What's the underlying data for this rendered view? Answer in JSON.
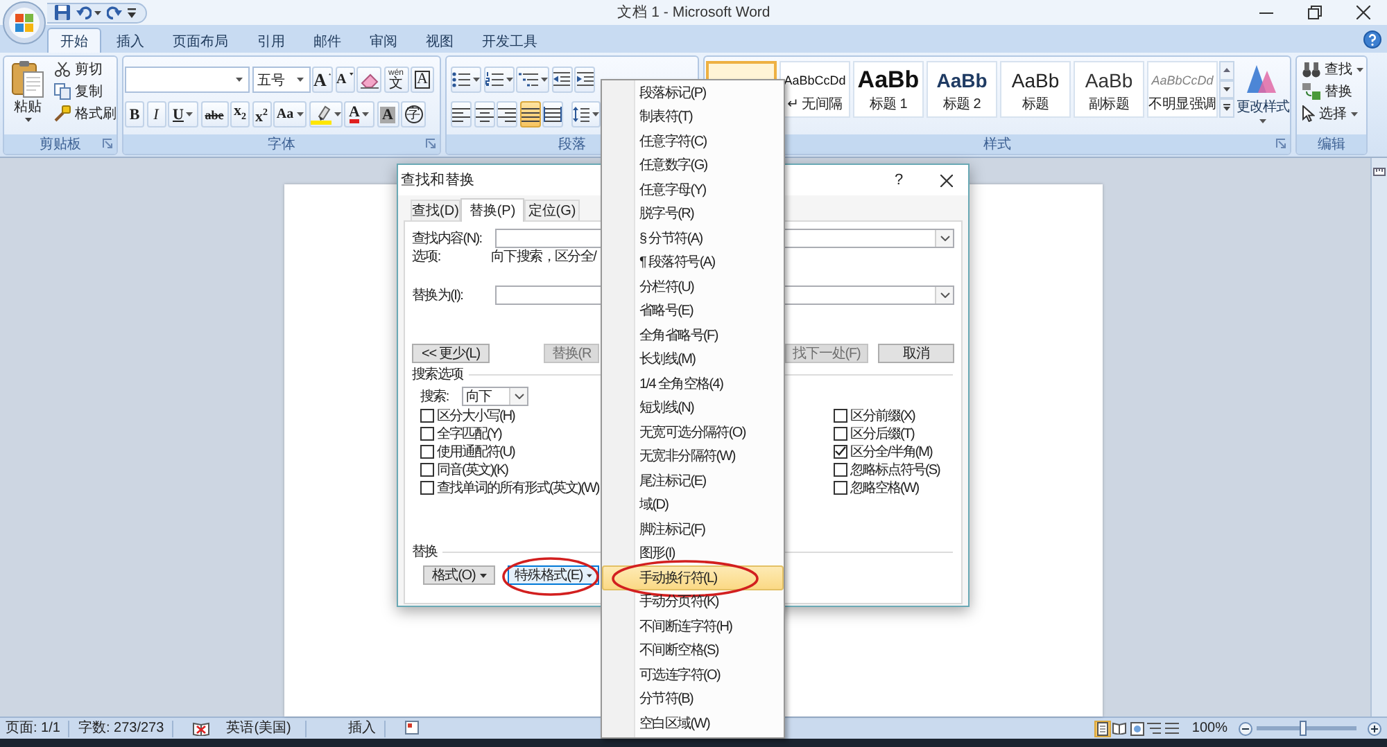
{
  "window": {
    "title": "文档 1 - Microsoft Word"
  },
  "quick_access": [
    {
      "kind": "save",
      "dropdown": false
    },
    {
      "kind": "undo",
      "dropdown": true
    },
    {
      "kind": "redo",
      "dropdown": false
    },
    {
      "kind": "customize",
      "dropdown": false
    }
  ],
  "tabs": [
    {
      "label": "开始",
      "selected": true
    },
    {
      "label": "插入",
      "selected": false
    },
    {
      "label": "页面布局",
      "selected": false
    },
    {
      "label": "引用",
      "selected": false
    },
    {
      "label": "邮件",
      "selected": false
    },
    {
      "label": "审阅",
      "selected": false
    },
    {
      "label": "视图",
      "selected": false
    },
    {
      "label": "开发工具",
      "selected": false
    }
  ],
  "ribbon": {
    "clipboard": {
      "label": "剪贴板",
      "paste": "粘贴",
      "commands": [
        {
          "kind": "cut",
          "label": "剪切"
        },
        {
          "kind": "copy",
          "label": "复制"
        },
        {
          "kind": "painter",
          "label": "格式刷"
        }
      ]
    },
    "font": {
      "label": "字体",
      "size": "五号",
      "row1": [
        {
          "kind": "grow",
          "label": "A"
        },
        {
          "kind": "shrink",
          "label": "A"
        },
        {
          "kind": "clear"
        },
        {
          "kind": "phonetic",
          "label": "文",
          "ruby": "wén"
        },
        {
          "kind": "border",
          "label": "A"
        }
      ],
      "row2": [
        {
          "kind": "bold",
          "label": "B",
          "dropdown": false
        },
        {
          "kind": "italic",
          "label": "I",
          "dropdown": false
        },
        {
          "kind": "underline",
          "label": "U",
          "dropdown": true
        },
        {
          "kind": "strike",
          "label": "abe",
          "dropdown": false
        },
        {
          "kind": "sub",
          "label": "x$_{2}$",
          "dropdown": false
        },
        {
          "kind": "sup",
          "label": "x$^{2}$",
          "dropdown": false
        },
        {
          "kind": "case",
          "label": "Aa",
          "dropdown": true
        },
        {
          "kind": "highlight",
          "dropdown": true
        },
        {
          "kind": "color",
          "label": "A",
          "dropdown": true
        },
        {
          "kind": "shading",
          "label": "A",
          "dropdown": false
        },
        {
          "kind": "enclose",
          "label": "字",
          "dropdown": false
        }
      ]
    },
    "paragraph": {
      "label": "段落",
      "row1": [
        {
          "kind": "bullets",
          "dropdown": true
        },
        {
          "kind": "numbering",
          "dropdown": true
        },
        {
          "kind": "multilevel",
          "dropdown": true
        },
        {
          "kind": "outdent",
          "dropdown": false
        },
        {
          "kind": "indent",
          "dropdown": false
        }
      ],
      "row2": [
        {
          "kind": "left",
          "selected": false,
          "dropdown": false
        },
        {
          "kind": "center",
          "selected": false,
          "dropdown": false
        },
        {
          "kind": "right",
          "selected": false,
          "dropdown": false
        },
        {
          "kind": "justify",
          "selected": true,
          "dropdown": false
        },
        {
          "kind": "distribute",
          "selected": false,
          "dropdown": false
        },
        {
          "kind": "spacing",
          "selected": false,
          "dropdown": true
        }
      ]
    },
    "styles": {
      "label": "样式",
      "items": [
        {
          "selected": true
        },
        {
          "kind": "plain",
          "preview": "AaBbCcDd",
          "name": "↵ 无间隔",
          "selected": false
        },
        {
          "kind": "heading1",
          "preview": "AaBb",
          "name": "标题 1",
          "selected": false
        },
        {
          "kind": "heading2",
          "preview": "AaBb",
          "name": "标题 2",
          "selected": false
        },
        {
          "kind": "title",
          "preview": "AaBb",
          "name": "标题",
          "selected": false
        },
        {
          "kind": "subtitle",
          "preview": "AaBb",
          "name": "副标题",
          "selected": false
        },
        {
          "kind": "subtle",
          "preview": "AaBbCcDd",
          "name": "不明显强调",
          "selected": false
        }
      ],
      "change": "更改样式"
    },
    "editing": {
      "label": "编辑",
      "items": [
        {
          "kind": "find",
          "label": "查找",
          "dropdown": true
        },
        {
          "kind": "replace",
          "label": "替换",
          "dropdown": false
        },
        {
          "kind": "select",
          "label": "选择",
          "dropdown": true
        }
      ]
    }
  },
  "dialog": {
    "title": "查找和替换",
    "help": "?",
    "tabs": [
      {
        "label": "查找(D)",
        "selected": false
      },
      {
        "label": "替换(P)",
        "selected": true
      },
      {
        "label": "定位(G)",
        "selected": false
      }
    ],
    "find": {
      "label": "查找内容(N):"
    },
    "options": {
      "label": "选项:",
      "value": "向下搜索，区分全/"
    },
    "replace": {
      "label": "替换为(I):"
    },
    "buttons": [
      {
        "label": "<< 更少(L)",
        "disabled": false
      },
      {
        "label": "替换(R",
        "disabled": true
      },
      {
        "label": "找下一处(F)",
        "disabled": true
      },
      {
        "label": "取消",
        "disabled": false
      }
    ],
    "search": {
      "heading": "搜索选项",
      "direction_label": "搜索:",
      "direction": "向下",
      "left": [
        {
          "label": "区分大小写(H)",
          "checked": false
        },
        {
          "label": "全字匹配(Y)",
          "checked": false
        },
        {
          "label": "使用通配符(U)",
          "checked": false
        },
        {
          "label": "同音(英文)(K)",
          "checked": false
        },
        {
          "label": "查找单词的所有形式(英文)(W)",
          "checked": false
        }
      ],
      "right": [
        {
          "label": "区分前缀(X)",
          "checked": false
        },
        {
          "label": "区分后缀(T)",
          "checked": false
        },
        {
          "label": "区分全/半角(M)",
          "checked": true
        },
        {
          "label": "忽略标点符号(S)",
          "checked": false
        },
        {
          "label": "忽略空格(W)",
          "checked": false
        }
      ]
    },
    "replace_section": {
      "heading": "替换",
      "buttons": [
        {
          "label": "格式(O)",
          "pressed": false,
          "circled": false
        },
        {
          "label": "特殊格式(E)",
          "pressed": true,
          "circled": true
        }
      ]
    }
  },
  "special_menu": {
    "items": [
      {
        "label": "段落标记(P)",
        "highlighted": false,
        "circled": false
      },
      {
        "label": "制表符(T)",
        "highlighted": false,
        "circled": false
      },
      {
        "label": "任意字符(C)",
        "highlighted": false,
        "circled": false
      },
      {
        "label": "任意数字(G)",
        "highlighted": false,
        "circled": false
      },
      {
        "label": "任意字母(Y)",
        "highlighted": false,
        "circled": false
      },
      {
        "label": "脱字号(R)",
        "highlighted": false,
        "circled": false
      },
      {
        "label": "§ 分节符(A)",
        "highlighted": false,
        "circled": false
      },
      {
        "label": "¶ 段落符号(A)",
        "highlighted": false,
        "circled": false
      },
      {
        "label": "分栏符(U)",
        "highlighted": false,
        "circled": false
      },
      {
        "label": "省略号(E)",
        "highlighted": false,
        "circled": false
      },
      {
        "label": "全角省略号(F)",
        "highlighted": false,
        "circled": false
      },
      {
        "label": "长划线(M)",
        "highlighted": false,
        "circled": false
      },
      {
        "label": "1/4 全角空格(4)",
        "highlighted": false,
        "circled": false
      },
      {
        "label": "短划线(N)",
        "highlighted": false,
        "circled": false
      },
      {
        "label": "无宽可选分隔符(O)",
        "highlighted": false,
        "circled": false
      },
      {
        "label": "无宽非分隔符(W)",
        "highlighted": false,
        "circled": false
      },
      {
        "label": "尾注标记(E)",
        "highlighted": false,
        "circled": false
      },
      {
        "label": "域(D)",
        "highlighted": false,
        "circled": false
      },
      {
        "label": "脚注标记(F)",
        "highlighted": false,
        "circled": false
      },
      {
        "label": "图形(I)",
        "highlighted": false,
        "circled": false
      },
      {
        "label": "手动换行符(L)",
        "highlighted": true,
        "circled": true
      },
      {
        "label": "手动分页符(K)",
        "highlighted": false,
        "circled": false
      },
      {
        "label": "不间断连字符(H)",
        "highlighted": false,
        "circled": false
      },
      {
        "label": "不间断空格(S)",
        "highlighted": false,
        "circled": false
      },
      {
        "label": "可选连字符(O)",
        "highlighted": false,
        "circled": false
      },
      {
        "label": "分节符(B)",
        "highlighted": false,
        "circled": false
      },
      {
        "label": "空白区域(W)",
        "highlighted": false,
        "circled": false
      }
    ]
  },
  "status_bar": {
    "page": "页面: 1/1",
    "words": "字数: 273/273",
    "language": "英语(美国)",
    "mode": "插入",
    "views": [
      {
        "kind": "print",
        "selected": true
      },
      {
        "kind": "reading",
        "selected": false
      },
      {
        "kind": "web",
        "selected": false
      },
      {
        "kind": "outline",
        "selected": false
      },
      {
        "kind": "draft",
        "selected": false
      }
    ],
    "zoom": "100%",
    "zoom_slider": {
      "level": 0.47
    }
  }
}
